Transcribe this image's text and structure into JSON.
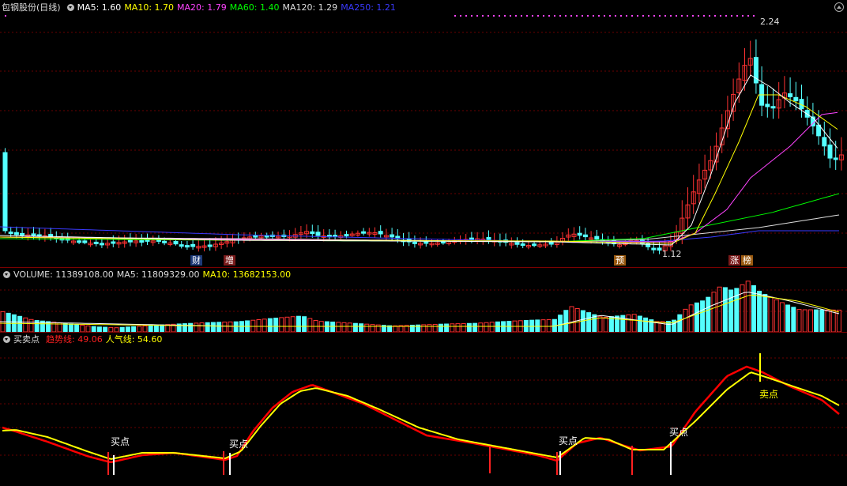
{
  "main": {
    "title": "包钢股份(日线)",
    "ma5": "MA5: 1.60",
    "ma10": "MA10: 1.70",
    "ma20": "MA20: 1.79",
    "ma60": "MA60: 1.40",
    "ma120": "MA120: 1.29",
    "ma250": "MA250: 1.21",
    "high_label": "2.24",
    "low_label": "1.12",
    "tags": [
      "财",
      "增",
      "预",
      "涨",
      "榜"
    ]
  },
  "volume": {
    "label": "VOLUME: 11389108.00",
    "ma5": "MA5: 11809329.00",
    "ma10": "MA10: 13682153.00"
  },
  "signal": {
    "name": "买卖点",
    "trend": "趋势线: 49.06",
    "pop": "人气线: 54.60",
    "buy": "买点",
    "sell": "卖点"
  },
  "colors": {
    "up": "#ff3232",
    "down": "#54ffff",
    "ma5": "#ffffff",
    "ma10": "#ffff00",
    "ma20": "#ff44ff",
    "ma60": "#00ff00",
    "ma120": "#dddddd",
    "ma250": "#3a3aff",
    "trend": "#ff0000",
    "pop": "#ffff00"
  }
}
